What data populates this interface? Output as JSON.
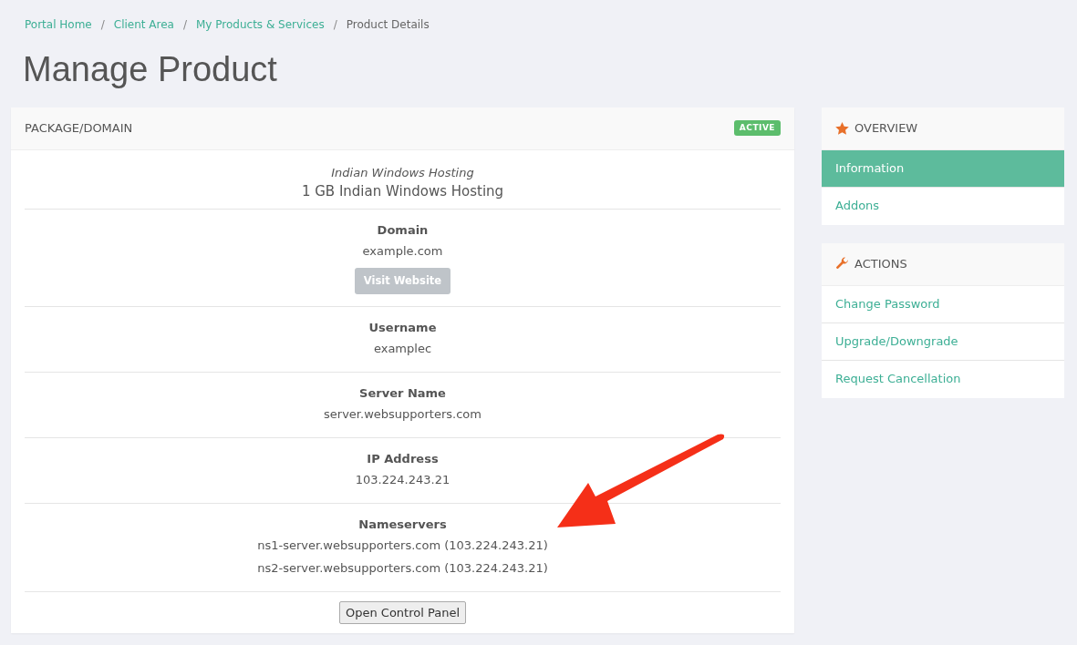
{
  "breadcrumb": [
    {
      "label": "Portal Home",
      "active": false
    },
    {
      "separator": "/",
      "label": "Client Area",
      "active": false
    },
    {
      "separator": "/",
      "label": "My Products & Services",
      "active": false
    },
    {
      "separator": "/",
      "label": "Product Details",
      "active": true
    }
  ],
  "title": "Manage Product",
  "package": {
    "header": "PACKAGE/DOMAIN",
    "status": "ACTIVE",
    "product_group": "Indian Windows Hosting",
    "product_name": "1 GB Indian Windows Hosting",
    "sections": [
      {
        "label": "Domain",
        "values": [
          "example.com"
        ],
        "button": {
          "label": "Visit Website",
          "disabled": true
        }
      },
      {
        "label": "Username",
        "values": [
          "examplec"
        ]
      },
      {
        "label": "Server Name",
        "values": [
          "server.websupporters.com"
        ]
      },
      {
        "label": "IP Address",
        "values": [
          "103.224.243.21"
        ]
      },
      {
        "label": "Nameservers",
        "values": [
          "ns1-server.websupporters.com (103.224.243.21)",
          "ns2-server.websupporters.com (103.224.243.21)"
        ]
      }
    ],
    "control_panel_button": "Open Control Panel"
  },
  "sidebar": [
    {
      "title": "OVERVIEW",
      "kind": "star",
      "items": [
        {
          "label": "Information",
          "selected": true
        },
        {
          "label": "Addons",
          "selected": false
        }
      ]
    },
    {
      "title": "ACTIONS",
      "kind": "wrench",
      "items": [
        {
          "label": "Change Password",
          "selected": false
        },
        {
          "label": "Upgrade/Downgrade",
          "selected": false
        },
        {
          "label": "Request Cancellation",
          "selected": false
        }
      ]
    }
  ]
}
